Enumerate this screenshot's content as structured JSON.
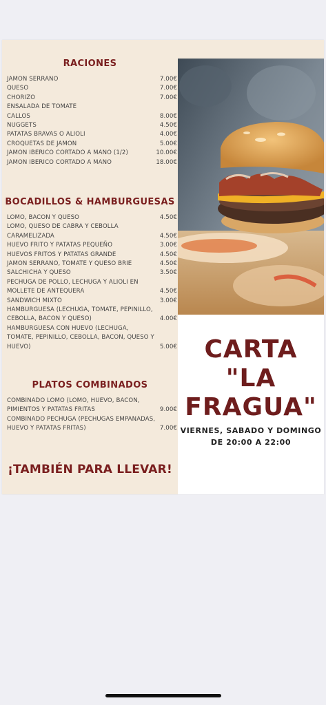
{
  "sections": {
    "raciones": {
      "title": "RACIONES",
      "items": [
        {
          "name": "JAMON SERRANO",
          "price": "7.00€"
        },
        {
          "name": "QUESO",
          "price": "7.00€"
        },
        {
          "name": "CHORIZO",
          "price": "7.00€"
        },
        {
          "name": "ENSALADA DE TOMATE",
          "price": ""
        },
        {
          "name": "CALLOS",
          "price": "8.00€"
        },
        {
          "name": "NUGGETS",
          "price": "4.50€"
        },
        {
          "name": "PATATAS BRAVAS O ALIOLI",
          "price": "4.00€"
        },
        {
          "name": "CROQUETAS DE JAMON",
          "price": "5.00€"
        },
        {
          "name": "JAMON IBERICO CORTADO A MANO (1/2)",
          "price": "10.00€"
        },
        {
          "name": "JAMON IBERICO CORTADO A MANO",
          "price": "18.00€"
        }
      ]
    },
    "bocadillos": {
      "title": "BOCADILLOS & HAMBURGUESAS",
      "items": [
        {
          "name": "LOMO, BACON Y QUESO",
          "price": "4.50€"
        },
        {
          "name": "LOMO, QUESO DE CABRA Y CEBOLLA CARAMELIZADA",
          "price": "4.50€"
        },
        {
          "name": "HUEVO FRITO Y PATATAS PEQUEÑO",
          "price": "3.00€"
        },
        {
          "name": "HUEVOS FRITOS Y PATATAS GRANDE",
          "price": "4.50€"
        },
        {
          "name": "JAMON SERRANO, TOMATE Y QUESO BRIE",
          "price": "4.50€"
        },
        {
          "name": "SALCHICHA Y QUESO",
          "price": "3.50€"
        },
        {
          "name": "PECHUGA DE POLLO, LECHUGA Y ALIOLI EN MOLLETE DE ANTEQUERA",
          "price": "4.50€"
        },
        {
          "name": "SANDWICH MIXTO",
          "price": "3.00€"
        },
        {
          "name": "HAMBURGUESA (LECHUGA, TOMATE, PEPINILLO, CEBOLLA, BACON Y QUESO)",
          "price": "4.00€"
        },
        {
          "name": "HAMBURGUESA CON HUEVO (LECHUGA, TOMATE, PEPINILLO, CEBOLLA, BACON, QUESO Y HUEVO)",
          "price": "5.00€"
        }
      ]
    },
    "platos": {
      "title": "PLATOS COMBINADOS",
      "items": [
        {
          "name": "COMBINADO LOMO (LOMO, HUEVO, BACON, PIMIENTOS Y PATATAS FRITAS",
          "price": "9.00€"
        },
        {
          "name": "COMBINADO PECHUGA (PECHUGAS EMPANADAS, HUEVO Y PATATAS FRITAS)",
          "price": "7.00€"
        }
      ]
    }
  },
  "takeaway": "¡TAMBIÉN PARA LLEVAR!",
  "carta": {
    "title": "CARTA \"LA FRAGUA\"",
    "days": "VIERNES, SABADO Y DOMINGO",
    "hours": "DE 20:00 A 22:00"
  },
  "colors": {
    "accent": "#7a1f1f",
    "card_bg": "#f4eadc"
  }
}
